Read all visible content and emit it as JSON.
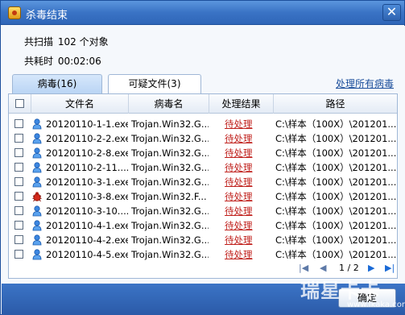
{
  "window": {
    "title": "杀毒结束"
  },
  "summary": {
    "scanned_label": "共扫描",
    "scanned_value": "102 个对象",
    "time_label": "共耗时",
    "time_value": "00:02:06"
  },
  "tabs": [
    {
      "label": "病毒(16)"
    },
    {
      "label": "可疑文件(3)"
    }
  ],
  "actions": {
    "handle_all": "处理所有病毒"
  },
  "table": {
    "headers": {
      "filename": "文件名",
      "virus": "病毒名",
      "result": "处理结果",
      "path": "路径"
    },
    "rows": [
      {
        "icon": "person-file-icon",
        "filename": "20120110-1-1.exe",
        "virus": "Trojan.Win32.G...",
        "result": "待处理",
        "path": "C:\\样本（100X）\\201201..."
      },
      {
        "icon": "person-file-icon",
        "filename": "20120110-2-2.exe",
        "virus": "Trojan.Win32.G...",
        "result": "待处理",
        "path": "C:\\样本（100X）\\201201..."
      },
      {
        "icon": "person-file-icon",
        "filename": "20120110-2-8.exe",
        "virus": "Trojan.Win32.G...",
        "result": "待处理",
        "path": "C:\\样本（100X）\\201201..."
      },
      {
        "icon": "person-file-icon",
        "filename": "20120110-2-11....",
        "virus": "Trojan.Win32.G...",
        "result": "待处理",
        "path": "C:\\样本（100X）\\201201..."
      },
      {
        "icon": "person-file-icon",
        "filename": "20120110-3-1.exe",
        "virus": "Trojan.Win32.G...",
        "result": "待处理",
        "path": "C:\\样本（100X）\\201201..."
      },
      {
        "icon": "bug-icon",
        "filename": "20120110-3-8.exe",
        "virus": "Trojan.Win32.F...",
        "result": "待处理",
        "path": "C:\\样本（100X）\\201201..."
      },
      {
        "icon": "person-file-icon",
        "filename": "20120110-3-10....",
        "virus": "Trojan.Win32.G...",
        "result": "待处理",
        "path": "C:\\样本（100X）\\201201..."
      },
      {
        "icon": "person-file-icon",
        "filename": "20120110-4-1.exe",
        "virus": "Trojan.Win32.G...",
        "result": "待处理",
        "path": "C:\\样本（100X）\\201201..."
      },
      {
        "icon": "person-file-icon",
        "filename": "20120110-4-2.exe",
        "virus": "Trojan.Win32.G...",
        "result": "待处理",
        "path": "C:\\样本（100X）\\201201..."
      },
      {
        "icon": "person-file-icon",
        "filename": "20120110-4-5.exe",
        "virus": "Trojan.Win32.G...",
        "result": "待处理",
        "path": "C:\\样本（100X）\\201201..."
      }
    ]
  },
  "pager": {
    "first": "|◀",
    "prev": "◀",
    "page": "1 / 2",
    "next": "▶",
    "last": "▶|"
  },
  "footer": {
    "ok": "确定"
  },
  "watermark": {
    "text": "瑞星卡卡",
    "url": "www.ikaka.com"
  },
  "colors": {
    "titlebar": "#3a73c5",
    "result_red": "#c0211d",
    "link_blue": "#1c4f9c"
  }
}
